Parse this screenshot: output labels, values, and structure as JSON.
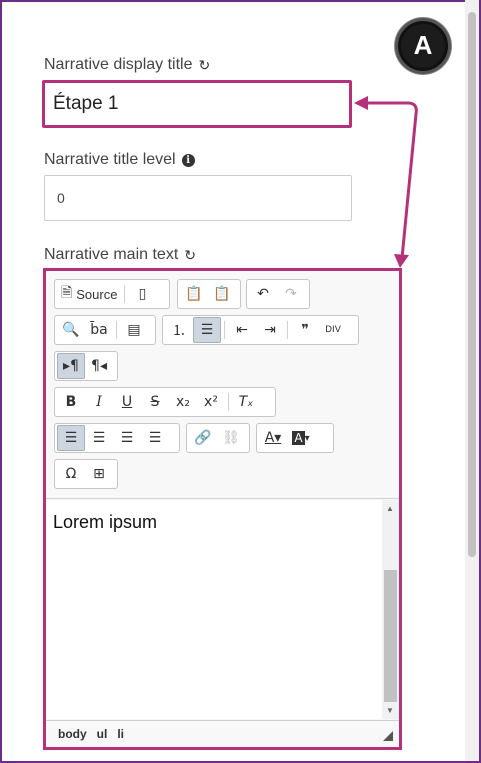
{
  "badge": {
    "letter": "A"
  },
  "fields": {
    "display_title": {
      "label": "Narrative display title",
      "value": "Étape 1"
    },
    "title_level": {
      "label": "Narrative title level",
      "value": "0"
    },
    "main_text": {
      "label": "Narrative main text"
    }
  },
  "editor": {
    "toolbar": {
      "source_label": "Source",
      "div_label": "DIV"
    },
    "content_text": "Lorem ipsum",
    "status_path": [
      "body",
      "ul",
      "li"
    ]
  },
  "colors": {
    "highlight": "#b5327a",
    "frame": "#6b2d86"
  }
}
